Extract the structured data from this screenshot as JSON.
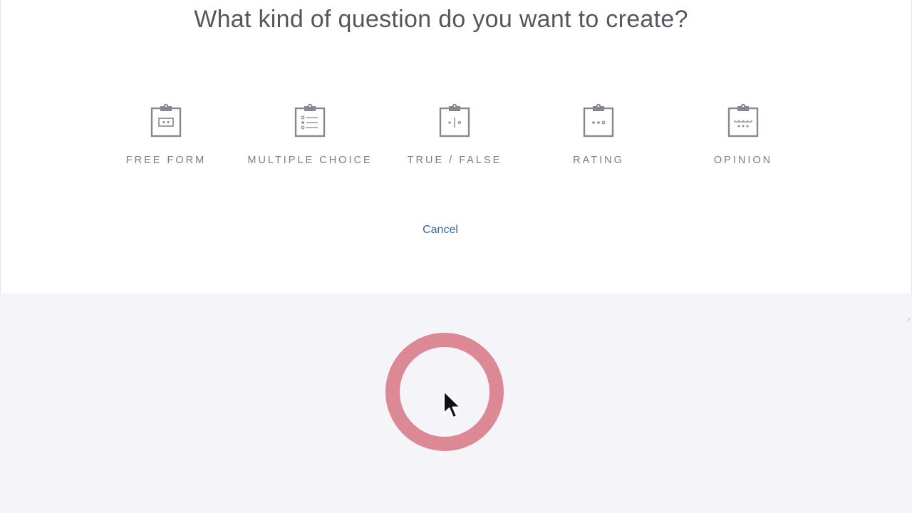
{
  "page": {
    "title": "What kind of question do you want to create?"
  },
  "question_types": [
    {
      "label": "FREE FORM",
      "icon": "clipboard-free-form-icon"
    },
    {
      "label": "MULTIPLE CHOICE",
      "icon": "clipboard-list-icon"
    },
    {
      "label": "TRUE / FALSE",
      "icon": "clipboard-true-false-icon"
    },
    {
      "label": "RATING",
      "icon": "clipboard-rating-icon"
    },
    {
      "label": "OPINION",
      "icon": "clipboard-opinion-icon"
    }
  ],
  "actions": {
    "cancel_label": "Cancel"
  },
  "colors": {
    "title": "#55575f",
    "icon_stroke": "#85888f",
    "label": "#7a7d85",
    "link": "#3567a6",
    "lower_background": "#f5f4f9",
    "click_ring": "#da828f"
  }
}
